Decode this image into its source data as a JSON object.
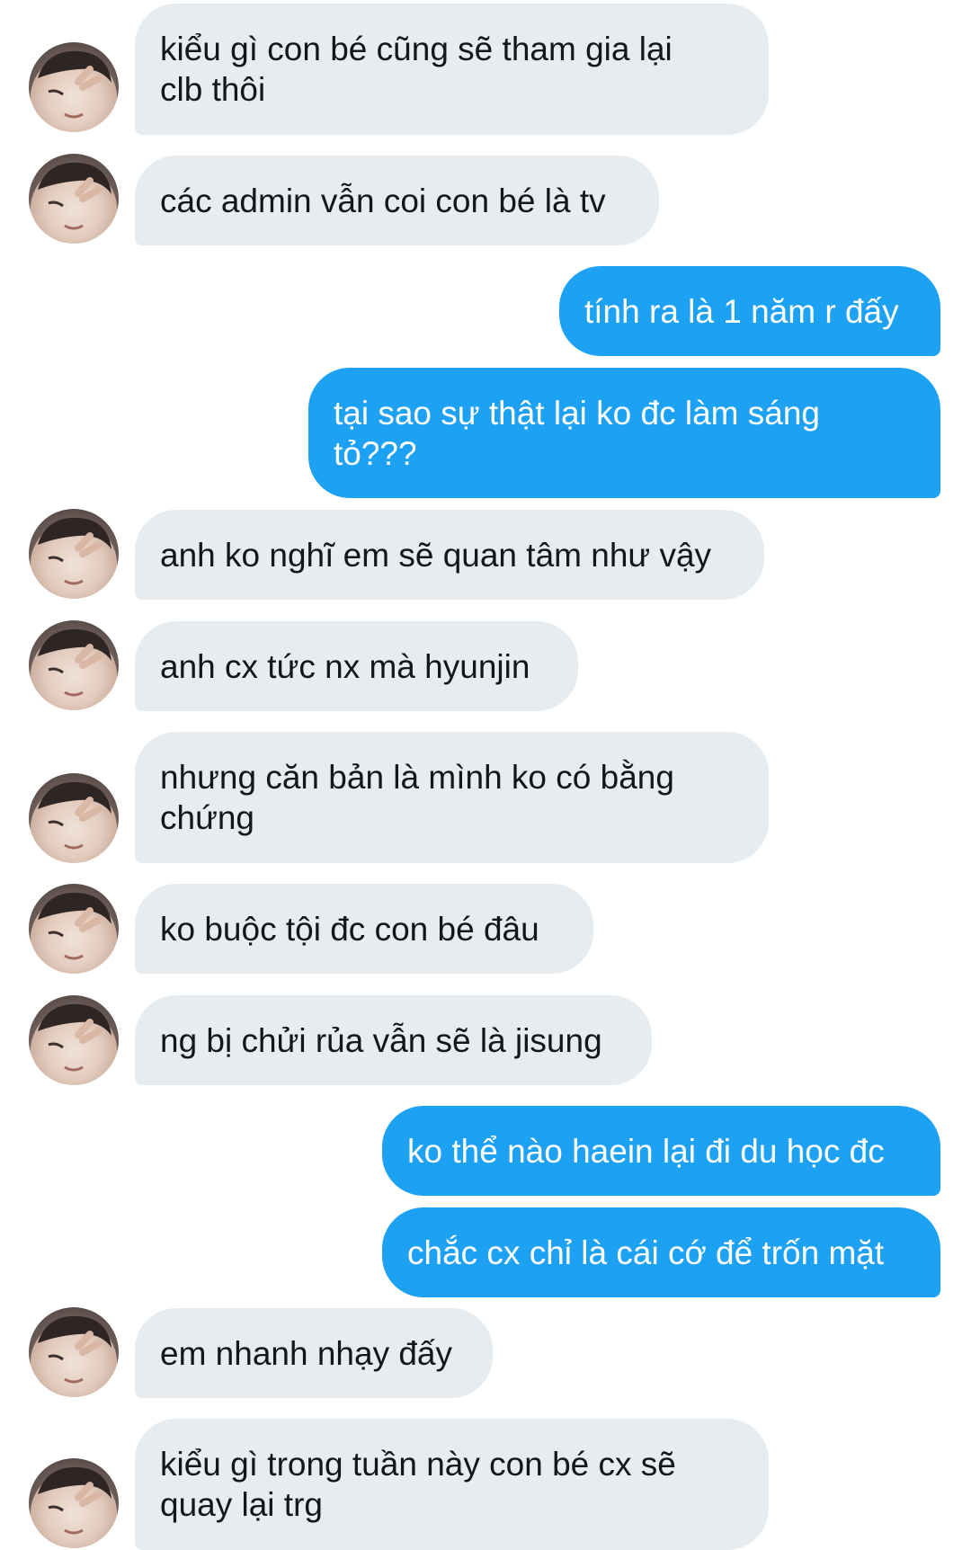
{
  "conversation": {
    "avatar_icon": "user-avatar-icon",
    "colors": {
      "incoming_bubble": "#e6ecf0",
      "incoming_text": "#14171a",
      "outgoing_bubble": "#1da1f2",
      "outgoing_text": "#ffffff",
      "background": "#ffffff"
    },
    "messages": [
      {
        "sender": "other",
        "text": "kiểu gì con bé cũng sẽ tham gia lại\nclb thôi"
      },
      {
        "sender": "other",
        "text": "các admin vẫn coi con bé là tv"
      },
      {
        "sender": "me",
        "text": "tính ra là 1 năm r đấy"
      },
      {
        "sender": "me",
        "text": "tại sao sự thật lại ko đc làm sáng\ntỏ???"
      },
      {
        "sender": "other",
        "text": "anh ko nghĩ em sẽ quan tâm như vậy"
      },
      {
        "sender": "other",
        "text": "anh cx tức nx mà hyunjin"
      },
      {
        "sender": "other",
        "text": "nhưng căn bản là mình ko có bằng\nchứng"
      },
      {
        "sender": "other",
        "text": "ko buộc tội đc con bé đâu"
      },
      {
        "sender": "other",
        "text": "ng bị chửi rủa vẫn sẽ là jisung"
      },
      {
        "sender": "me",
        "text": "ko thể nào haein lại đi du học đc"
      },
      {
        "sender": "me",
        "text": "chắc cx chỉ là cái cớ để trốn mặt"
      },
      {
        "sender": "other",
        "text": "em nhanh nhạy đấy"
      },
      {
        "sender": "other",
        "text": "kiểu gì trong tuần này con bé cx sẽ\nquay lại trg"
      }
    ]
  }
}
